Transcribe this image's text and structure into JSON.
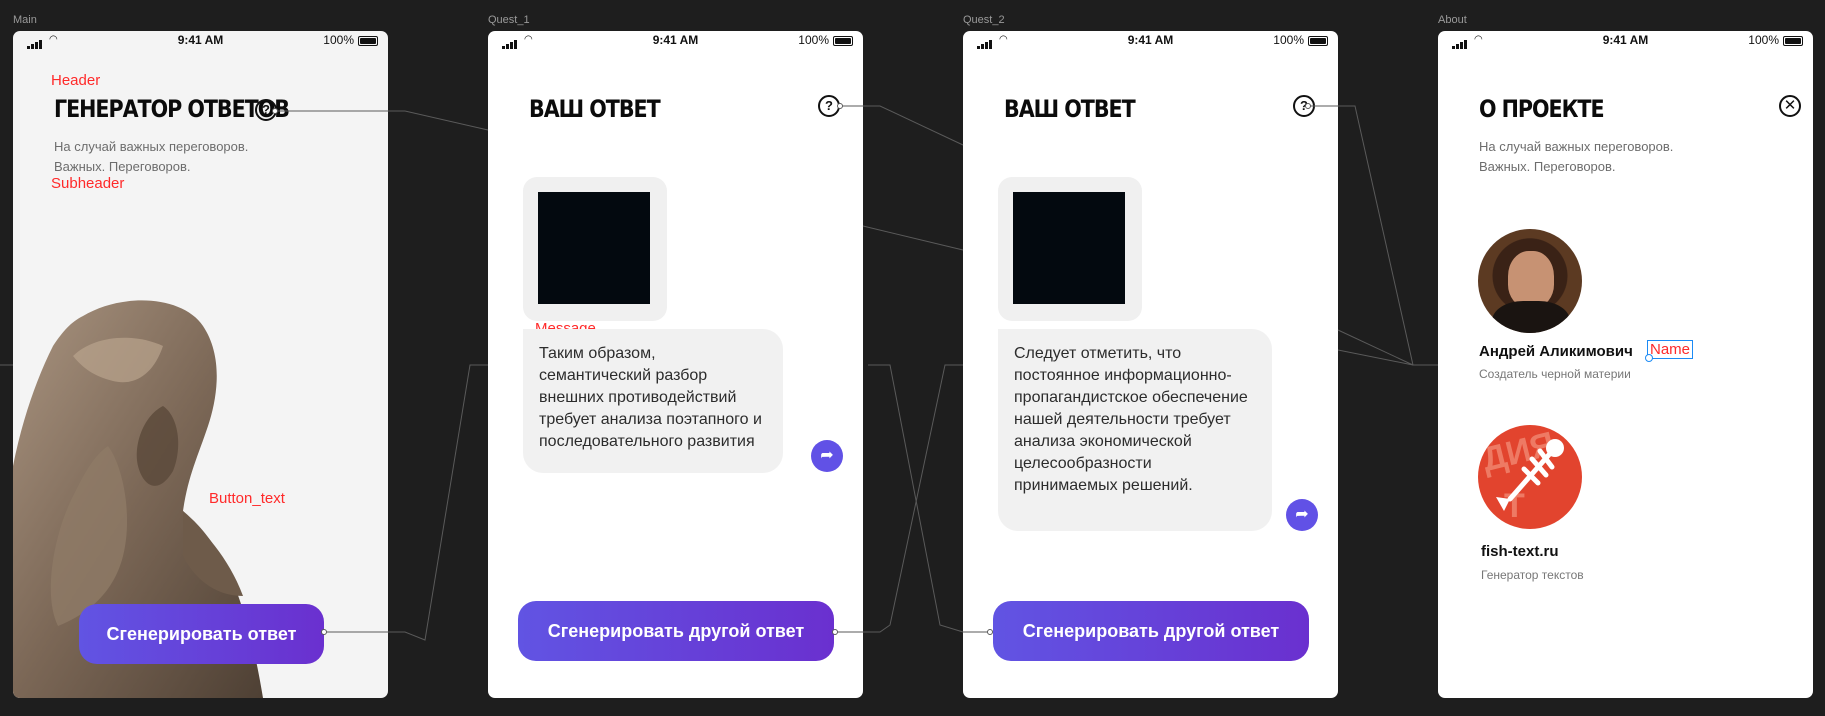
{
  "frames": {
    "main": {
      "label": "Main",
      "title": "ГЕНЕРАТОР ОТВЕТОВ",
      "subtitle_lines": [
        "На случай важных переговоров.",
        "Важных. Переговоров."
      ],
      "button": "Сгенерировать ответ",
      "annotations": {
        "header": "Header",
        "subheader": "Subheader",
        "button_text": "Button_text"
      },
      "help_icon": "?"
    },
    "quest1": {
      "label": "Quest_1",
      "title": "ВАШ ОТВЕТ",
      "annotation_message": "Message",
      "message": "Таким образом, семантический разбор внешних противодействий требует анализа поэтапного и последовательного развития",
      "button": "Сгенерировать другой ответ",
      "help_icon": "?"
    },
    "quest2": {
      "label": "Quest_2",
      "title": "ВАШ ОТВЕТ",
      "message": "Следует отметить, что постоянное информационно-пропагандистское обеспечение нашей деятельности требует анализа экономической целесообразности принимаемых решений.",
      "button": "Сгенерировать другой ответ",
      "help_icon": "?"
    },
    "about": {
      "label": "About",
      "title": "О ПРОЕКТЕ",
      "subtitle_lines": [
        "На случай важных переговоров.",
        "Важных. Переговоров."
      ],
      "person_name": "Андрей Аликимович",
      "person_role": "Создатель черной материи",
      "name_annotation": "Name",
      "site_name": "fish-text.ru",
      "site_role": "Генератор текстов",
      "close_icon": "✕"
    }
  },
  "status_bar": {
    "time": "9:41 AM",
    "battery": "100%"
  },
  "icons": {
    "share": "share-arrow-icon",
    "help": "question-circle-icon",
    "close": "close-circle-icon"
  },
  "colors": {
    "canvas": "#1e1e1e",
    "accent": "#6151e6",
    "annotation": "#ff2a2a"
  }
}
